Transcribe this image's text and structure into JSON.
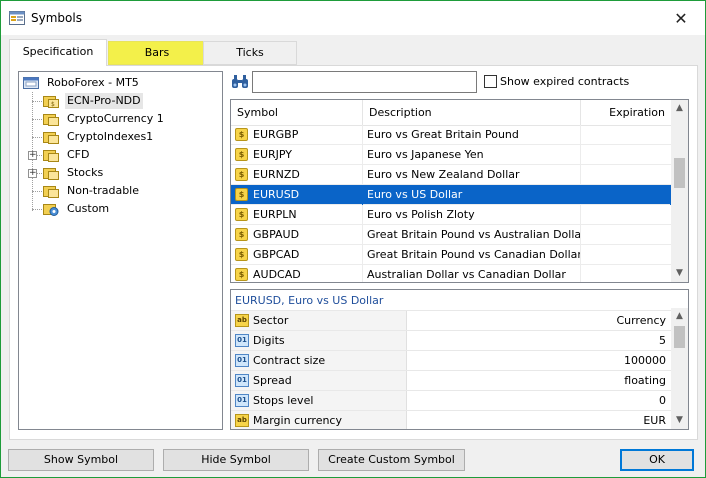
{
  "window": {
    "title": "Symbols",
    "close_glyph": "✕"
  },
  "tabs": [
    {
      "label": "Specification",
      "active": true
    },
    {
      "label": "Bars",
      "highlight_color": "#f3f04a"
    },
    {
      "label": "Ticks"
    }
  ],
  "tree": {
    "root": "RoboForex - MT5",
    "items": [
      {
        "label": "ECN-Pro-NDD",
        "selected": true,
        "icon": "folder-symbols-icon"
      },
      {
        "label": "CryptoCurrency 1",
        "icon": "folder-symbols-icon"
      },
      {
        "label": "CryptoIndexes1",
        "icon": "folder-symbols-icon"
      },
      {
        "label": "CFD",
        "expandable": true,
        "icon": "folder-symbols-icon"
      },
      {
        "label": "Stocks",
        "expandable": true,
        "icon": "folder-symbols-icon"
      },
      {
        "label": "Non-tradable",
        "icon": "folder-symbols-icon"
      },
      {
        "label": "Custom",
        "icon": "folder-custom-icon"
      }
    ]
  },
  "search": {
    "value": "",
    "expired_label": "Show expired contracts",
    "expired_checked": false
  },
  "symbols": {
    "columns": [
      "Symbol",
      "Description",
      "Expiration"
    ],
    "rows": [
      {
        "symbol": "EURGBP",
        "description": "Euro vs Great Britain Pound"
      },
      {
        "symbol": "EURJPY",
        "description": "Euro vs Japanese Yen"
      },
      {
        "symbol": "EURNZD",
        "description": "Euro vs New Zealand Dollar"
      },
      {
        "symbol": "EURUSD",
        "description": "Euro vs US Dollar",
        "selected": true
      },
      {
        "symbol": "EURPLN",
        "description": "Euro vs Polish Zloty"
      },
      {
        "symbol": "GBPAUD",
        "description": "Great Britain Pound vs Australian Dollar"
      },
      {
        "symbol": "GBPCAD",
        "description": "Great Britain Pound vs Canadian Dollar"
      },
      {
        "symbol": "AUDCAD",
        "description": "Australian Dollar vs Canadian Dollar"
      }
    ],
    "selection_color": "#0a64c8"
  },
  "properties": {
    "caption": "EURUSD, Euro vs US Dollar",
    "rows": [
      {
        "name": "Sector",
        "value": "Currency",
        "icon": "text-property-icon"
      },
      {
        "name": "Digits",
        "value": "5",
        "icon": "numeric-property-icon"
      },
      {
        "name": "Contract size",
        "value": "100000",
        "icon": "numeric-property-icon"
      },
      {
        "name": "Spread",
        "value": "floating",
        "icon": "numeric-property-icon"
      },
      {
        "name": "Stops level",
        "value": "0",
        "icon": "numeric-property-icon"
      },
      {
        "name": "Margin currency",
        "value": "EUR",
        "icon": "text-property-icon"
      }
    ]
  },
  "buttons": {
    "show_symbol": "Show Symbol",
    "hide_symbol": "Hide Symbol",
    "create_custom": "Create Custom Symbol",
    "ok": "OK"
  }
}
